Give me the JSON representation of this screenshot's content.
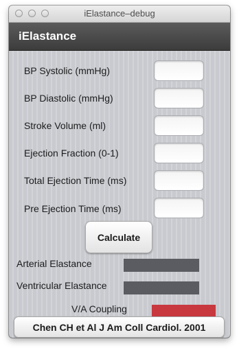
{
  "window": {
    "title": "iElastance–debug"
  },
  "app": {
    "title": "iElastance"
  },
  "form": {
    "fields": [
      {
        "label": "BP Systolic (mmHg)",
        "value": "",
        "placeholder": ""
      },
      {
        "label": "BP Diastolic (mmHg)",
        "value": "",
        "placeholder": ""
      },
      {
        "label": "Stroke Volume (ml)",
        "value": "",
        "placeholder": ""
      },
      {
        "label": "Ejection Fraction (0-1)",
        "value": "",
        "placeholder": ""
      },
      {
        "label": "Total Ejection Time (ms)",
        "value": "",
        "placeholder": ""
      },
      {
        "label": "Pre Ejection Time (ms)",
        "value": "",
        "placeholder": ""
      }
    ],
    "calculate_label": "Calculate"
  },
  "results": {
    "arterial_label": "Arterial Elastance",
    "ventricular_label": "Ventricular Elastance",
    "coupling_label": "V/A Coupling",
    "colors": {
      "elastance_bar": "#5a5c61",
      "coupling_bar": "#c8383f"
    }
  },
  "reference": {
    "label": "Chen CH et Al J Am Coll Cardiol. 2001"
  }
}
